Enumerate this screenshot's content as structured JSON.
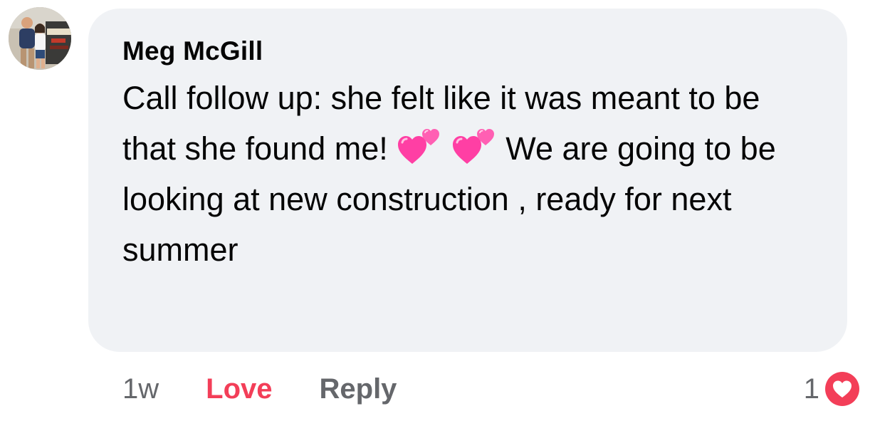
{
  "comment": {
    "author": "Meg McGill",
    "text_part_1": "Call follow up: she felt like it was meant to be that she found me!",
    "emoji_1": "two-hearts-icon",
    "emoji_2": "two-hearts-icon",
    "text_part_2": "We are going to be looking at new construction , ready for next summer"
  },
  "actions": {
    "time": "1w",
    "love_label": "Love",
    "reply_label": "Reply"
  },
  "reactions": {
    "count": "1",
    "type": "love-reaction-icon"
  },
  "colors": {
    "love": "#f33e58",
    "bubble": "#f0f2f5",
    "secondary_text": "#65676b",
    "heart_pink": "#ff4fa7"
  }
}
